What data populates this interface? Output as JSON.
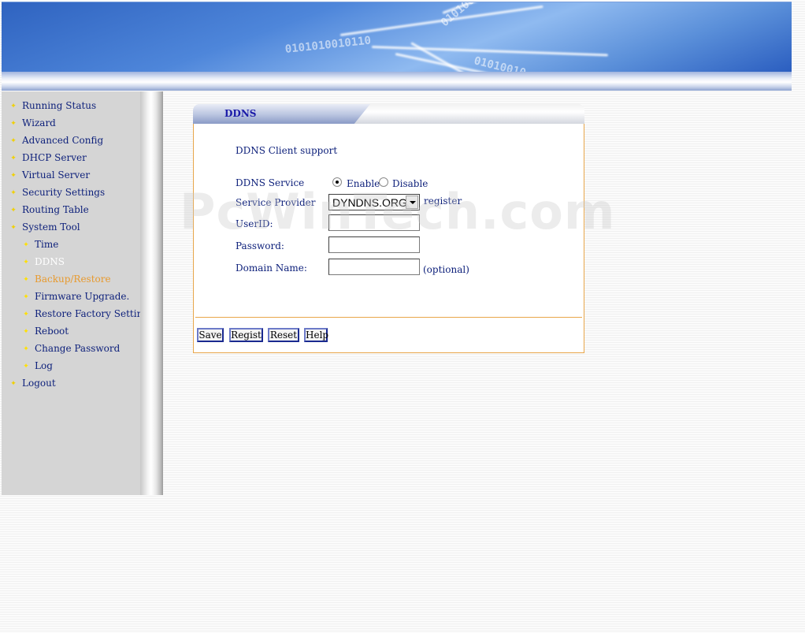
{
  "sidebar": {
    "items": [
      {
        "label": "Running Status"
      },
      {
        "label": "Wizard"
      },
      {
        "label": "Advanced Config"
      },
      {
        "label": "DHCP Server"
      },
      {
        "label": "Virtual Server"
      },
      {
        "label": "Security Settings"
      },
      {
        "label": "Routing Table"
      },
      {
        "label": "System Tool"
      },
      {
        "label": "Logout"
      }
    ],
    "subitems": [
      {
        "label": "Time"
      },
      {
        "label": "DDNS"
      },
      {
        "label": "Backup/Restore"
      },
      {
        "label": "Firmware Upgrade."
      },
      {
        "label": "Restore Factory Setting"
      },
      {
        "label": "Reboot"
      },
      {
        "label": "Change Password"
      },
      {
        "label": "Log"
      }
    ],
    "current_subitem": "DDNS",
    "highlight_subitem": "Backup/Restore"
  },
  "panel": {
    "title": "DDNS",
    "section_label": "DDNS Client support",
    "ddns_service_label": "DDNS Service",
    "enable_label": "Enable",
    "disable_label": "Disable",
    "ddns_service_value": "Enable",
    "service_provider_label": "Service Provider",
    "service_provider_value": "DYNDNS.ORG",
    "register_label": "register",
    "userid_label": "UserID:",
    "userid_value": "",
    "password_label": "Password:",
    "password_value": "",
    "domain_label": "Domain Name:",
    "domain_value": "",
    "optional_label": "(optional)"
  },
  "buttons": {
    "save": "Save",
    "regist": "Regist",
    "reset": "Reset",
    "help": "Help"
  },
  "watermark": "PcWinTech.com",
  "colors": {
    "link": "#0c1f7a",
    "accent_border": "#e8a64a",
    "banner_blue": "#4e86da",
    "sidebar_bg": "#d5d5d5",
    "highlight": "#e89a2e"
  }
}
